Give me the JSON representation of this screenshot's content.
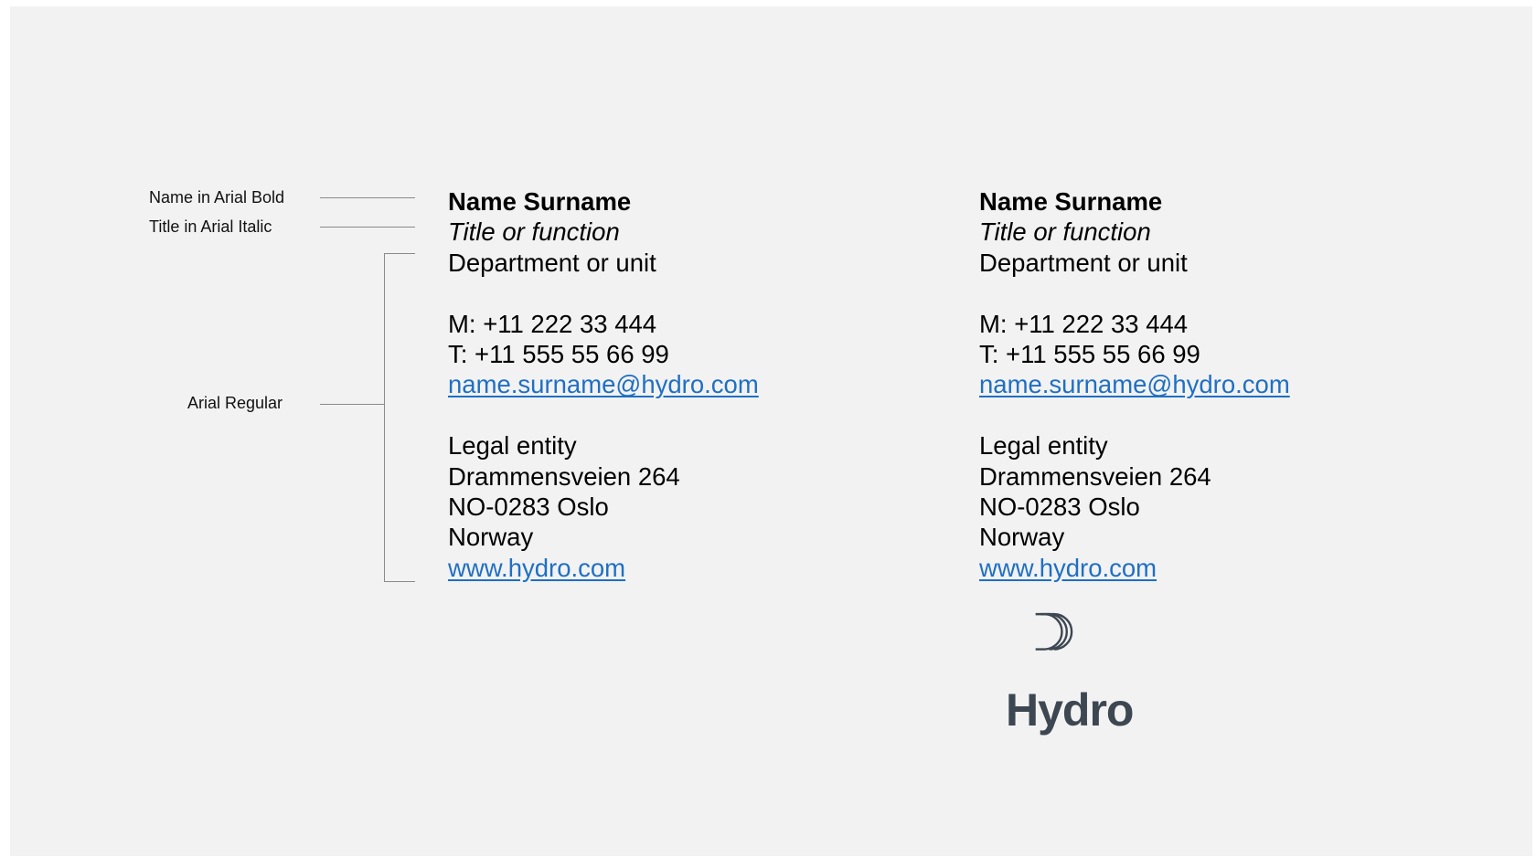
{
  "annotations": {
    "name_label": "Name in Arial Bold",
    "title_label": "Title in Arial Italic",
    "body_label": "Arial Regular"
  },
  "signature": {
    "name": "Name Surname",
    "title": "Title or function",
    "department": "Department or unit",
    "mobile": "M: +11 222 33 444",
    "phone": "T: +11 555 55 66 99",
    "email": "name.surname@hydro.com",
    "legal_entity": "Legal entity",
    "street": "Drammensveien 264",
    "city": "NO-0283 Oslo",
    "country": "Norway",
    "website": "www.hydro.com"
  },
  "logo": {
    "wordmark": "Hydro",
    "icon": "hydro-arcs-icon",
    "color": "#3d4752"
  },
  "colors": {
    "background": "#f2f2f2",
    "link": "#1f6fc4",
    "leader": "#8a8a8a"
  }
}
